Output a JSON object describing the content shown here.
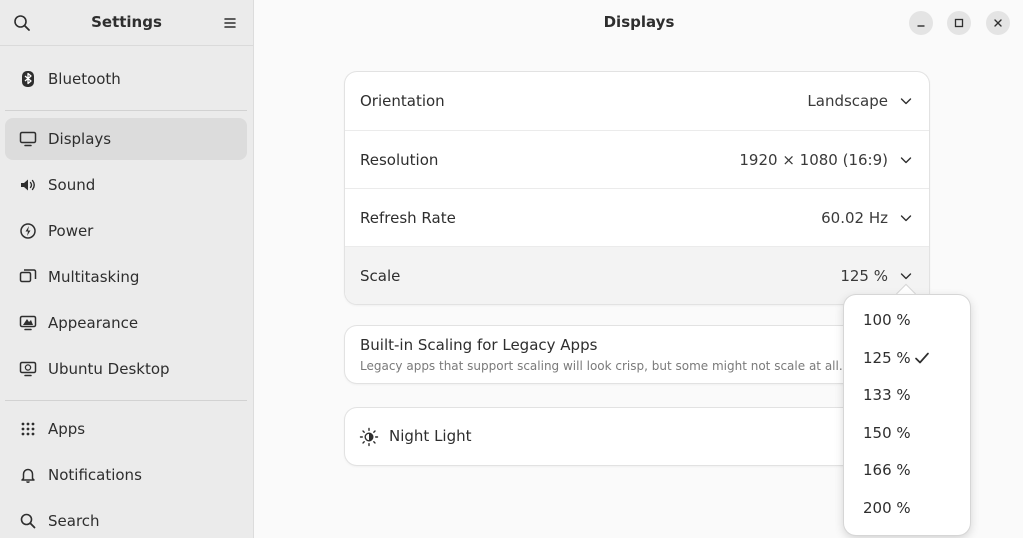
{
  "sidebar": {
    "title": "Settings",
    "items": [
      {
        "label": "Bluetooth",
        "icon": "bluetooth-icon"
      },
      {
        "label": "Displays",
        "icon": "display-icon"
      },
      {
        "label": "Sound",
        "icon": "speaker-icon"
      },
      {
        "label": "Power",
        "icon": "power-icon"
      },
      {
        "label": "Multitasking",
        "icon": "multitasking-icon"
      },
      {
        "label": "Appearance",
        "icon": "appearance-icon"
      },
      {
        "label": "Ubuntu Desktop",
        "icon": "ubuntu-desktop-icon"
      },
      {
        "label": "Apps",
        "icon": "apps-grid-icon"
      },
      {
        "label": "Notifications",
        "icon": "bell-icon"
      },
      {
        "label": "Search",
        "icon": "search-icon"
      }
    ],
    "active": "Displays"
  },
  "main": {
    "title": "Displays",
    "display_card": [
      {
        "label": "Orientation",
        "value": "Landscape"
      },
      {
        "label": "Resolution",
        "value": "1920 × 1080 (16:9)"
      },
      {
        "label": "Refresh Rate",
        "value": "60.02 Hz"
      },
      {
        "label": "Scale",
        "value": "125 %"
      }
    ],
    "legacy": {
      "title": "Built-in Scaling for Legacy Apps",
      "subtitle": "Legacy apps that support scaling will look crisp, but some might not scale at all."
    },
    "night_light": {
      "label": "Night Light"
    }
  },
  "scale_popover": {
    "options": [
      "100 %",
      "125 %",
      "133 %",
      "150 %",
      "166 %",
      "200 %"
    ],
    "selected": "125 %"
  },
  "colors": {
    "sidebar_bg": "#ebebeb",
    "active_item_bg": "#dcdcdc",
    "card_bg": "#ffffff",
    "window_bg": "#fafafa"
  }
}
